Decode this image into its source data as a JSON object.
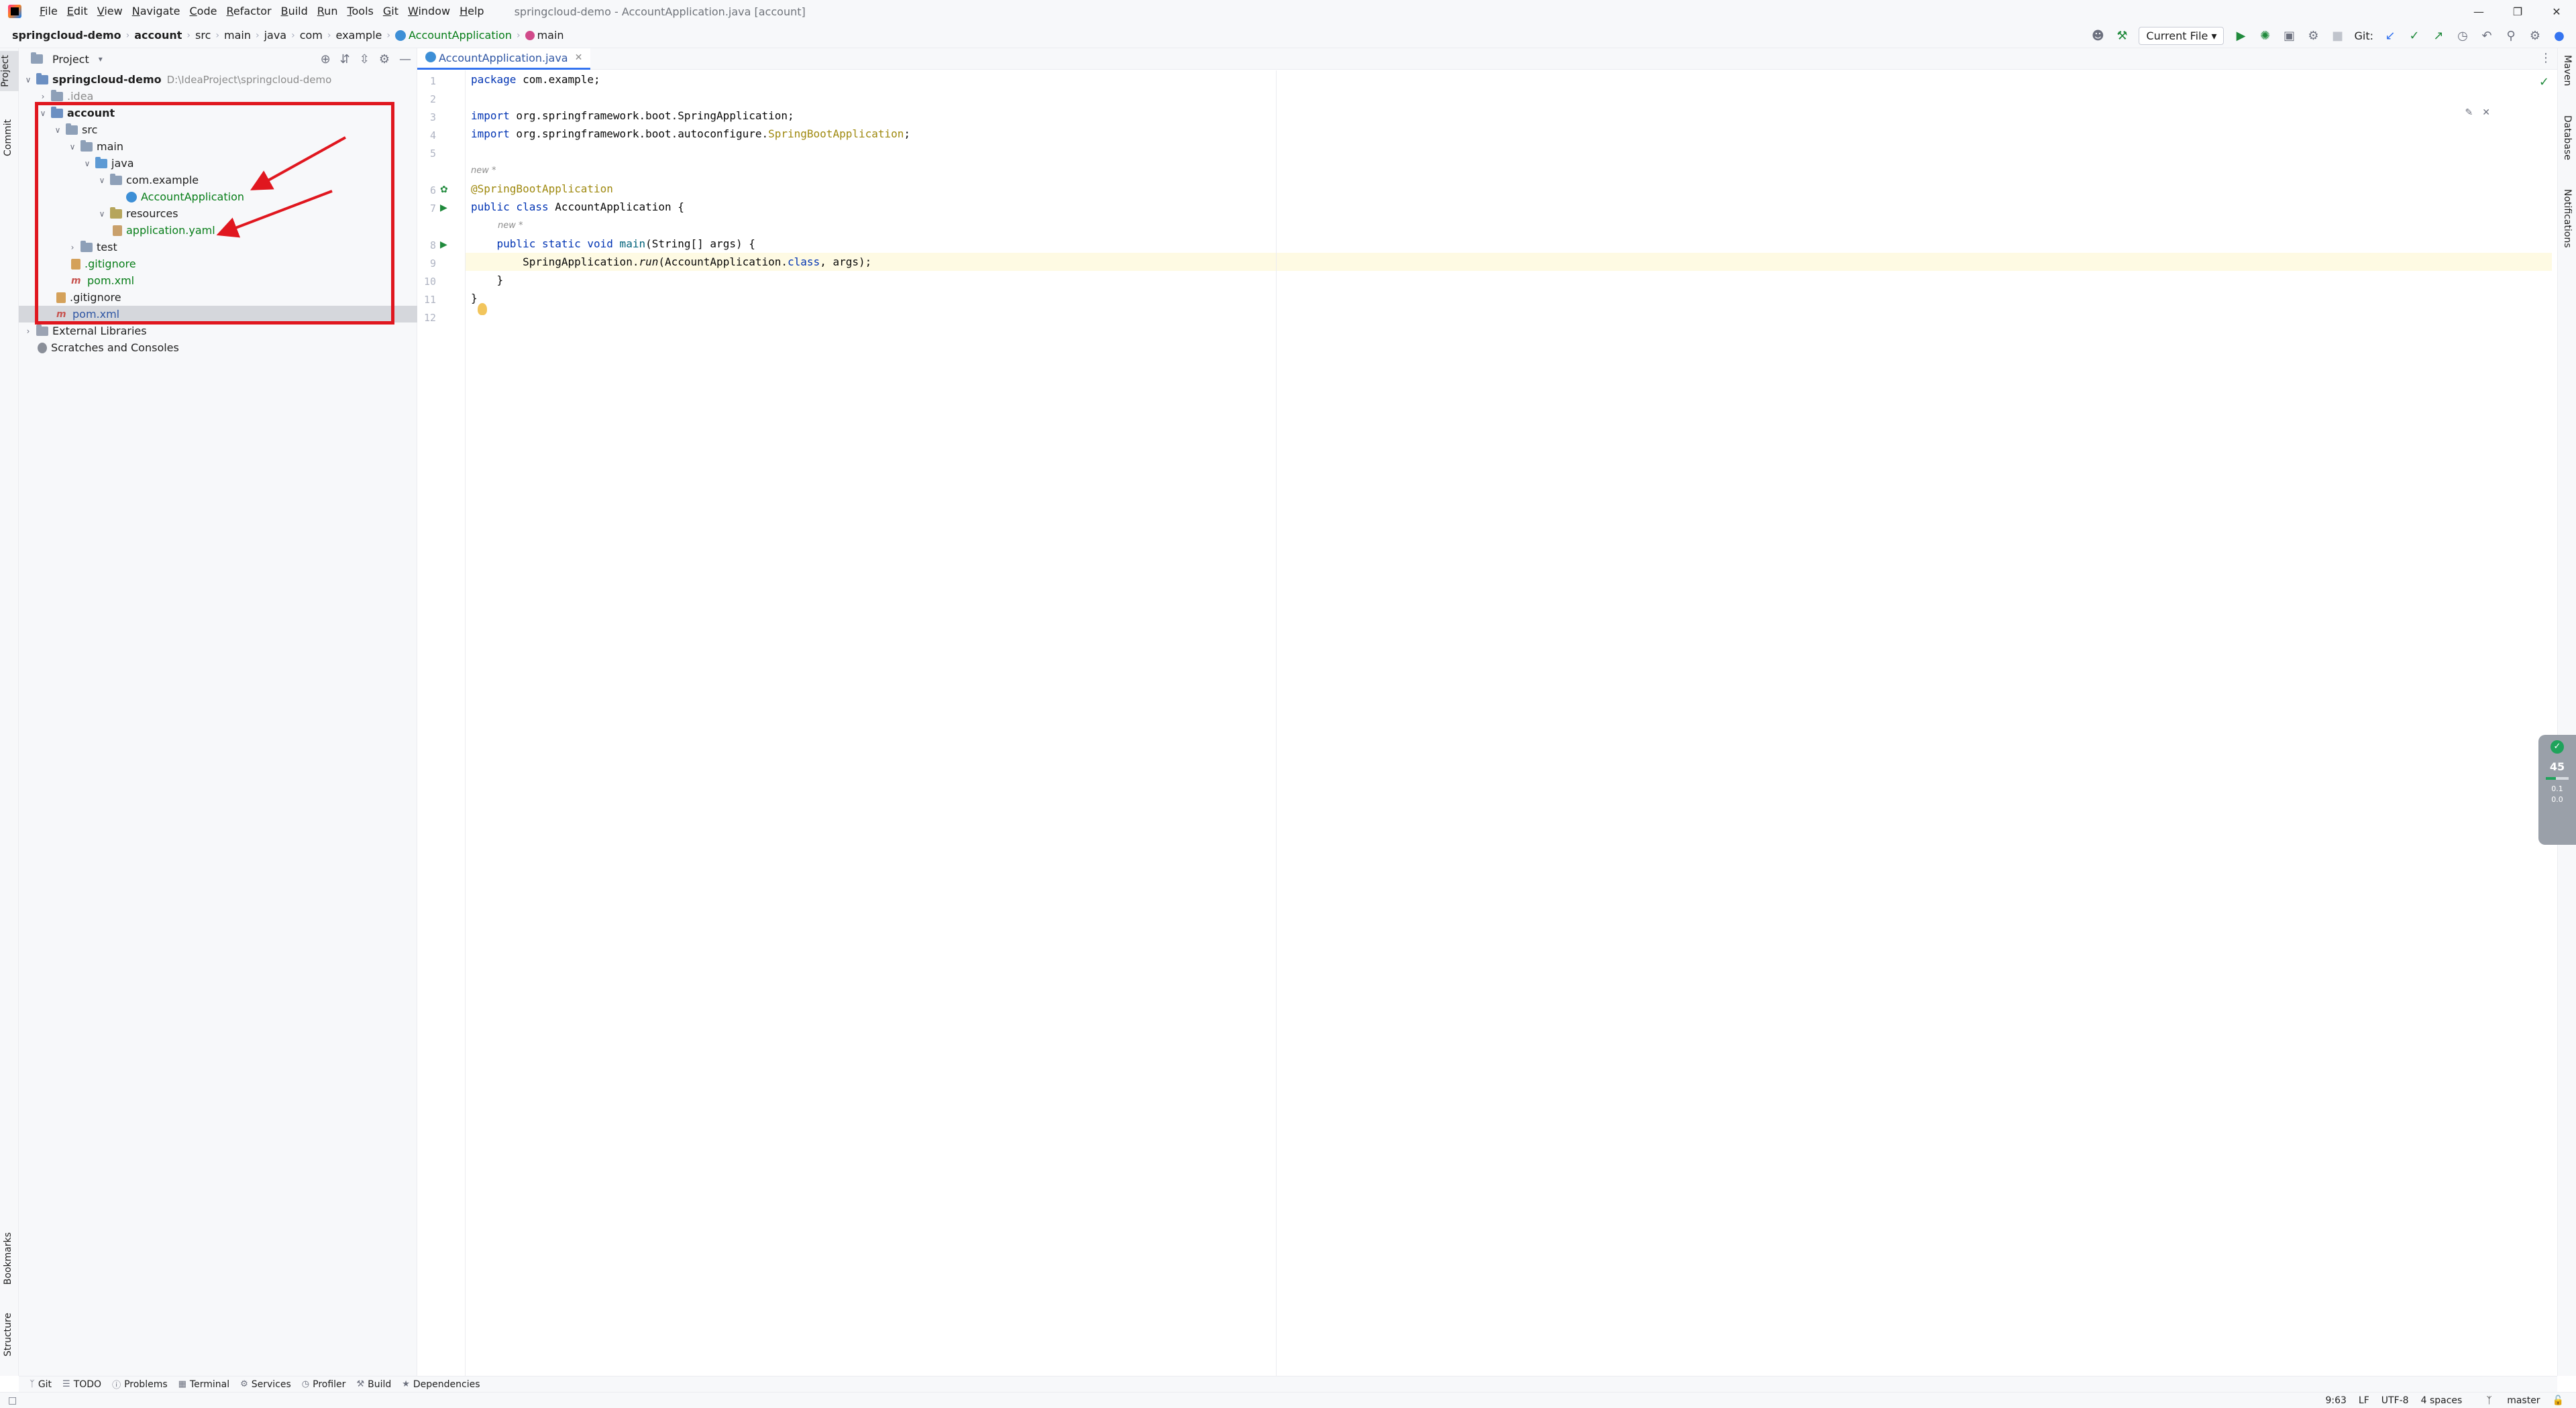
{
  "menubar": {
    "items": [
      "File",
      "Edit",
      "View",
      "Navigate",
      "Code",
      "Refactor",
      "Build",
      "Run",
      "Tools",
      "Git",
      "Window",
      "Help"
    ],
    "window_title": "springcloud-demo - AccountApplication.java [account]"
  },
  "breadcrumb": {
    "project": "springcloud-demo",
    "module": "account",
    "parts": [
      "src",
      "main",
      "java",
      "com",
      "example"
    ],
    "class_name": "AccountApplication",
    "method_name": "main"
  },
  "toolbar": {
    "run_config": "Current File",
    "git_label": "Git:"
  },
  "left_strip": {
    "tabs": [
      "Project",
      "Commit",
      "Bookmarks",
      "Structure"
    ]
  },
  "right_strip": {
    "tabs": [
      "Maven",
      "Database",
      "Notifications"
    ]
  },
  "project_panel": {
    "title": "Project",
    "tree": {
      "root_name": "springcloud-demo",
      "root_path": "D:\\IdeaProject\\springcloud-demo",
      "idea": ".idea",
      "account": "account",
      "src": "src",
      "main": "main",
      "java": "java",
      "package": "com.example",
      "app_class": "AccountApplication",
      "resources": "resources",
      "yaml": "application.yaml",
      "test": "test",
      "gitignore_module": ".gitignore",
      "pom_module": "pom.xml",
      "gitignore_root": ".gitignore",
      "pom_root": "pom.xml",
      "external_libraries": "External Libraries",
      "scratches": "Scratches and Consoles"
    }
  },
  "editor": {
    "tab_label": "AccountApplication.java",
    "line_numbers": [
      "1",
      "2",
      "3",
      "4",
      "5",
      "6",
      "7",
      "8",
      "9",
      "10",
      "11",
      "12"
    ],
    "hint_new": "new *",
    "code": {
      "l1_kw": "package",
      "l1_rest": " com.example;",
      "l3_kw": "import",
      "l3_rest": " org.springframework.boot.SpringApplication;",
      "l4_kw": "import",
      "l4_rest": " org.springframework.boot.autoconfigure.",
      "l4_cls": "SpringBootApplication",
      "l4_end": ";",
      "l6_ann": "@SpringBootApplication",
      "l7_kw": "public class",
      "l7_rest": " AccountApplication {",
      "l8_kw": "public static void",
      "l8_mth": " main",
      "l8_rest": "(String[] args) {",
      "l9_a": "SpringApplication.",
      "l9_mth": "run",
      "l9_b": "(AccountApplication.",
      "l9_kw": "class",
      "l9_c": ", args);",
      "l10": "}",
      "l11": "}"
    }
  },
  "memory_widget": {
    "value": "45",
    "used_fraction": 0.45,
    "line1": "0.1",
    "line2": "0.0"
  },
  "bottom_tabs": [
    "Git",
    "TODO",
    "Problems",
    "Terminal",
    "Services",
    "Profiler",
    "Build",
    "Dependencies"
  ],
  "status": {
    "position": "9:63",
    "line_sep": "LF",
    "encoding": "UTF-8",
    "indent": "4 spaces",
    "branch": "master"
  },
  "colors": {
    "annotation_red": "#e0171f",
    "accent_blue": "#3574f0",
    "file_green": "#067d17"
  }
}
